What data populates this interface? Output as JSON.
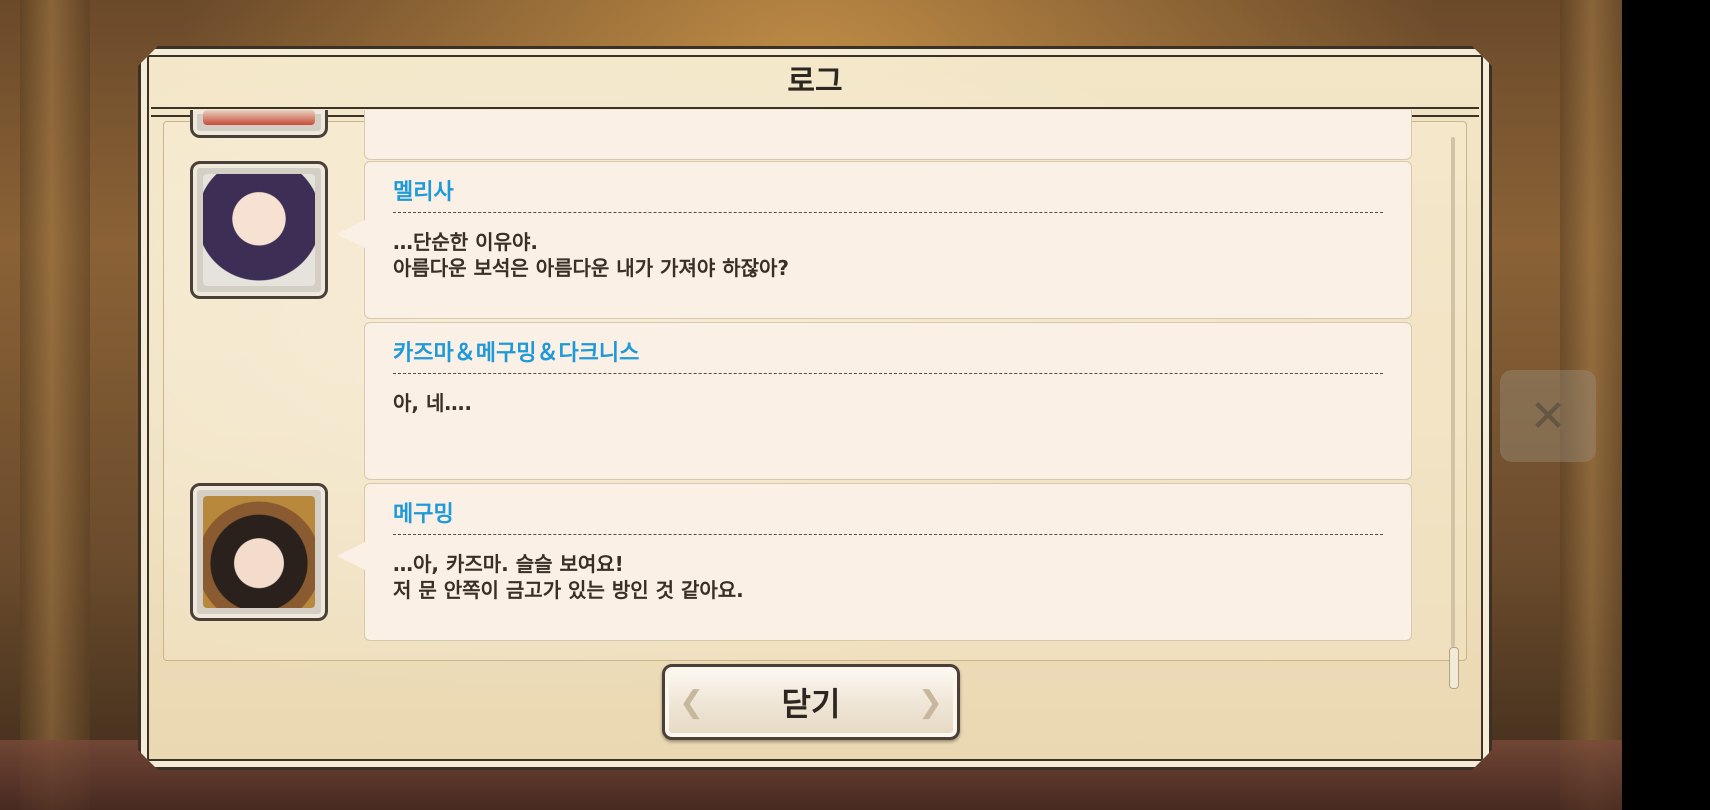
{
  "dialog": {
    "title": "로그",
    "close_label": "닫기"
  },
  "log": {
    "entries": [
      {
        "speaker": "멜리사",
        "lines": [
          "…단순한 이유야.",
          "아름다운 보석은 아름다운 내가 가져야 하잖아?"
        ],
        "portrait": "melissa-portrait"
      },
      {
        "speaker": "카즈마＆메구밍＆다크니스",
        "lines": [
          "아, 네….",
          ""
        ],
        "portrait": ""
      },
      {
        "speaker": "메구밍",
        "lines": [
          "…아, 카즈마. 슬슬 보여요!",
          "저 문 안쪽이 금고가 있는 방인 것 같아요."
        ],
        "portrait": "megumin-portrait"
      }
    ]
  },
  "colors": {
    "speaker": "#1e9ad8",
    "text": "#3a2f27",
    "parchment": "#f3e6c7"
  }
}
